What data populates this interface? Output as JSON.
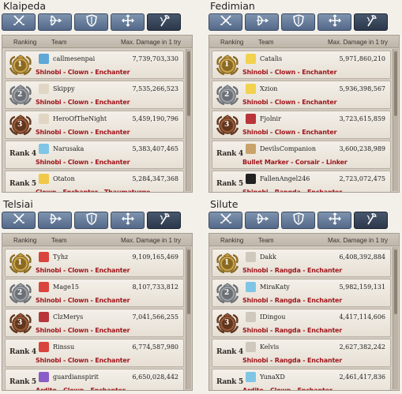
{
  "headers": {
    "ranking": "Ranking",
    "team": "Team",
    "damage": "Max. Damage in 1 try"
  },
  "colors": {
    "job_text": "#a0161c",
    "gold_medal": "#c9a24a",
    "silver_medal": "#9aa0a6",
    "bronze_medal": "#9a5b3a"
  },
  "tab_icons": [
    "swords-icon",
    "bow-icon",
    "shield-icon",
    "cross-arrows-icon",
    "staff-icon"
  ],
  "panels": [
    {
      "server": "Klaipeda",
      "rows": [
        {
          "rank": "1",
          "rank_label": "",
          "name": "callmesenpai",
          "damage": "7,739,703,330",
          "jobs": "Shinobi - Clown - Enchanter",
          "avatar": "#5fa8d8"
        },
        {
          "rank": "2",
          "rank_label": "",
          "name": "Skippy",
          "damage": "7,535,266,523",
          "jobs": "Shinobi - Clown - Enchanter",
          "avatar": "#e0d6c3"
        },
        {
          "rank": "3",
          "rank_label": "",
          "name": "HeroOfTheNight",
          "damage": "5,459,190,796",
          "jobs": "Shinobi - Clown - Enchanter",
          "avatar": "#e0d6c3"
        },
        {
          "rank": "",
          "rank_label": "Rank 4",
          "name": "Narusaka",
          "damage": "5,383,407,465",
          "jobs": "Shinobi - Clown - Enchanter",
          "avatar": "#7fc6e6"
        },
        {
          "rank": "",
          "rank_label": "Rank 5",
          "name": "Otaton",
          "damage": "5,284,347,368",
          "jobs": "Clown - Enchanter - Thaumaturge",
          "avatar": "#f0c84a"
        }
      ]
    },
    {
      "server": "Fedimian",
      "rows": [
        {
          "rank": "1",
          "rank_label": "",
          "name": "Catalis",
          "damage": "5,971,860,210",
          "jobs": "Shinobi - Clown - Enchanter",
          "avatar": "#f2d24e"
        },
        {
          "rank": "2",
          "rank_label": "",
          "name": "Xzion",
          "damage": "5,936,398,567",
          "jobs": "Shinobi - Clown - Enchanter",
          "avatar": "#f2d24e"
        },
        {
          "rank": "3",
          "rank_label": "",
          "name": "Fjolnir",
          "damage": "3,723,615,859",
          "jobs": "Shinobi - Clown - Enchanter",
          "avatar": "#b8353a"
        },
        {
          "rank": "",
          "rank_label": "Rank 4",
          "name": "DevilsCompanion",
          "damage": "3,600,238,989",
          "jobs": "Bullet Marker - Corsair - Linker",
          "avatar": "#c9a46a"
        },
        {
          "rank": "",
          "rank_label": "Rank 5",
          "name": "FallenAngel246",
          "damage": "2,723,072,475",
          "jobs": "Shinobi - Rangda - Enchanter",
          "avatar": "#222222"
        }
      ]
    },
    {
      "server": "Telsiai",
      "rows": [
        {
          "rank": "1",
          "rank_label": "",
          "name": "Tyhz",
          "damage": "9,109,165,469",
          "jobs": "Shinobi - Clown - Enchanter",
          "avatar": "#d9453d"
        },
        {
          "rank": "2",
          "rank_label": "",
          "name": "Mage15",
          "damage": "8,107,733,812",
          "jobs": "Shinobi - Clown - Enchanter",
          "avatar": "#d9453d"
        },
        {
          "rank": "3",
          "rank_label": "",
          "name": "ClzMerys",
          "damage": "7,041,566,255",
          "jobs": "Shinobi - Clown - Enchanter",
          "avatar": "#b8353a"
        },
        {
          "rank": "",
          "rank_label": "Rank 4",
          "name": "Rinssu",
          "damage": "6,774,587,980",
          "jobs": "Shinobi - Clown - Enchanter",
          "avatar": "#d9453d"
        },
        {
          "rank": "",
          "rank_label": "Rank 5",
          "name": "guardianspirit",
          "damage": "6,650,028,442",
          "jobs": "Ardito - Clown - Enchanter",
          "avatar": "#8a5cc7"
        }
      ]
    },
    {
      "server": "Silute",
      "rows": [
        {
          "rank": "1",
          "rank_label": "",
          "name": "Dakk",
          "damage": "6,408,392,884",
          "jobs": "Shinobi - Rangda - Enchanter",
          "avatar": "#cfc8bd"
        },
        {
          "rank": "2",
          "rank_label": "",
          "name": "MiraKaty",
          "damage": "5,982,159,131",
          "jobs": "Shinobi - Rangda - Enchanter",
          "avatar": "#7fc6e6"
        },
        {
          "rank": "3",
          "rank_label": "",
          "name": "IDingou",
          "damage": "4,417,114,606",
          "jobs": "Shinobi - Rangda - Enchanter",
          "avatar": "#cfc8bd"
        },
        {
          "rank": "",
          "rank_label": "Rank 4",
          "name": "Kelvis",
          "damage": "2,627,382,242",
          "jobs": "Shinobi - Rangda - Enchanter",
          "avatar": "#cfc8bd"
        },
        {
          "rank": "",
          "rank_label": "Rank 5",
          "name": "YunaXD",
          "damage": "2,461,417,836",
          "jobs": "Ardito - Clown - Enchanter",
          "avatar": "#7fc6e6"
        }
      ]
    }
  ]
}
